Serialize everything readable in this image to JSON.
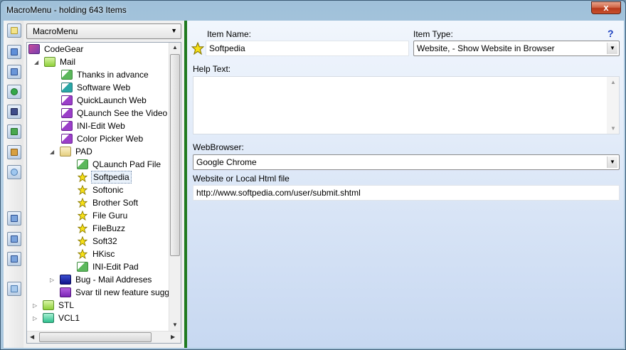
{
  "window": {
    "title": "MacroMenu - holding 643 Items",
    "close_glyph": "x"
  },
  "sidebar_combo": {
    "value": "MacroMenu"
  },
  "toolbar": {
    "buttons": [
      "new-item-icon",
      "open-folder-icon",
      "folder-up-icon",
      "refresh-icon",
      "save-icon",
      "edit-icon",
      "properties-icon",
      "find-icon",
      "move-up-icon",
      "move-right-icon",
      "move-down-icon",
      "copy-icon"
    ]
  },
  "tree": {
    "nodes": [
      {
        "label": "CodeGear",
        "icon": "codegear-icon"
      },
      {
        "label": "Mail",
        "icon": "folder-green-icon"
      },
      {
        "label": "Thanks in advance",
        "icon": "doc-green-icon"
      },
      {
        "label": "Software Web",
        "icon": "doc-teal-icon"
      },
      {
        "label": "QuickLaunch Web",
        "icon": "doc-purple-icon"
      },
      {
        "label": "QLaunch See the Video",
        "icon": "doc-purple-icon"
      },
      {
        "label": "INI-Edit Web",
        "icon": "doc-purple-icon"
      },
      {
        "label": "Color Picker Web",
        "icon": "doc-purple-icon"
      },
      {
        "label": "PAD",
        "icon": "folder-tan-icon"
      },
      {
        "label": "QLaunch Pad File",
        "icon": "doc-green-icon"
      },
      {
        "label": "Softpedia",
        "icon": "star-icon"
      },
      {
        "label": "Softonic",
        "icon": "star-icon"
      },
      {
        "label": "Brother Soft",
        "icon": "star-icon"
      },
      {
        "label": "File Guru",
        "icon": "star-icon"
      },
      {
        "label": "FileBuzz",
        "icon": "star-icon"
      },
      {
        "label": "Soft32",
        "icon": "star-icon"
      },
      {
        "label": "HKisc",
        "icon": "star-icon"
      },
      {
        "label": "INI-Edit Pad",
        "icon": "doc-green-icon"
      },
      {
        "label": "Bug - Mail Addreses",
        "icon": "folder-navy-icon"
      },
      {
        "label": "Svar til new feature suggestion",
        "icon": "folder-purple-icon"
      },
      {
        "label": "STL",
        "icon": "folder-green-icon"
      },
      {
        "label": "VCL1",
        "icon": "folder-green-icon"
      }
    ],
    "selected": "Softpedia"
  },
  "editor": {
    "item_name_label": "Item Name:",
    "item_name_value": "Softpedia",
    "item_type_label": "Item Type:",
    "item_type_value": "Website, - Show Website in Browser",
    "help_glyph": "?",
    "help_text_label": "Help Text:",
    "help_text_value": "",
    "webbrowser_label": "WebBrowser:",
    "webbrowser_value": "Google Chrome",
    "website_label": "Website or Local Html file",
    "website_value": "http://www.softpedia.com/user/submit.shtml"
  },
  "colors": {
    "splitter": "#1f7a1f",
    "selected_accent": "#6d86a8",
    "help_icon": "#1a3fbf"
  }
}
